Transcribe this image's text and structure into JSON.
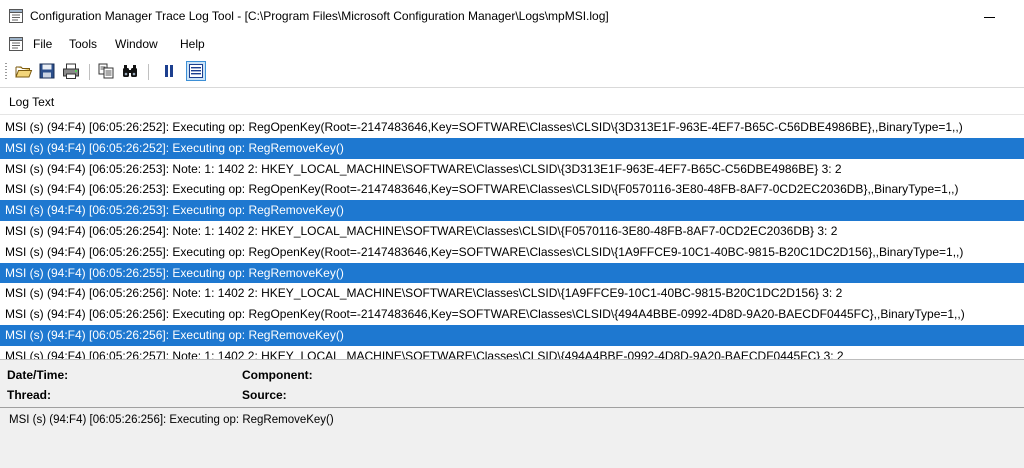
{
  "window": {
    "title": "Configuration Manager Trace Log Tool - [C:\\Program Files\\Microsoft Configuration Manager\\Logs\\mpMSI.log]"
  },
  "menu": {
    "items": [
      "File",
      "Tools",
      "Window",
      "Help"
    ]
  },
  "toolbar": {
    "buttons": [
      "open-icon",
      "save-icon",
      "print-icon",
      "copy-icon",
      "find-icon",
      "pause-icon",
      "highlight-icon"
    ]
  },
  "log": {
    "header": "Log Text",
    "rows": [
      {
        "text": "MSI (s) (94:F4) [06:05:26:252]: Executing op: RegOpenKey(Root=-2147483646,Key=SOFTWARE\\Classes\\CLSID\\{3D313E1F-963E-4EF7-B65C-C56DBE4986BE},,BinaryType=1,,)",
        "selected": false
      },
      {
        "text": "MSI (s) (94:F4) [06:05:26:252]: Executing op: RegRemoveKey()",
        "selected": true
      },
      {
        "text": "MSI (s) (94:F4) [06:05:26:253]: Note: 1: 1402 2: HKEY_LOCAL_MACHINE\\SOFTWARE\\Classes\\CLSID\\{3D313E1F-963E-4EF7-B65C-C56DBE4986BE} 3: 2",
        "selected": false
      },
      {
        "text": "MSI (s) (94:F4) [06:05:26:253]: Executing op: RegOpenKey(Root=-2147483646,Key=SOFTWARE\\Classes\\CLSID\\{F0570116-3E80-48FB-8AF7-0CD2EC2036DB},,BinaryType=1,,)",
        "selected": false
      },
      {
        "text": "MSI (s) (94:F4) [06:05:26:253]: Executing op: RegRemoveKey()",
        "selected": true
      },
      {
        "text": "MSI (s) (94:F4) [06:05:26:254]: Note: 1: 1402 2: HKEY_LOCAL_MACHINE\\SOFTWARE\\Classes\\CLSID\\{F0570116-3E80-48FB-8AF7-0CD2EC2036DB} 3: 2",
        "selected": false
      },
      {
        "text": "MSI (s) (94:F4) [06:05:26:255]: Executing op: RegOpenKey(Root=-2147483646,Key=SOFTWARE\\Classes\\CLSID\\{1A9FFCE9-10C1-40BC-9815-B20C1DC2D156},,BinaryType=1,,)",
        "selected": false
      },
      {
        "text": "MSI (s) (94:F4) [06:05:26:255]: Executing op: RegRemoveKey()",
        "selected": true
      },
      {
        "text": "MSI (s) (94:F4) [06:05:26:256]: Note: 1: 1402 2: HKEY_LOCAL_MACHINE\\SOFTWARE\\Classes\\CLSID\\{1A9FFCE9-10C1-40BC-9815-B20C1DC2D156} 3: 2",
        "selected": false
      },
      {
        "text": "MSI (s) (94:F4) [06:05:26:256]: Executing op: RegOpenKey(Root=-2147483646,Key=SOFTWARE\\Classes\\CLSID\\{494A4BBE-0992-4D8D-9A20-BAECDF0445FC},,BinaryType=1,,)",
        "selected": false
      },
      {
        "text": "MSI (s) (94:F4) [06:05:26:256]: Executing op: RegRemoveKey()",
        "selected": true
      },
      {
        "text": "MSI (s) (94:F4) [06:05:26:257]: Note: 1: 1402 2: HKEY_LOCAL_MACHINE\\SOFTWARE\\Classes\\CLSID\\{494A4BBE-0992-4D8D-9A20-BAECDF0445FC} 3: 2",
        "selected": false
      }
    ]
  },
  "details": {
    "datetime_label": "Date/Time:",
    "datetime_value": "",
    "component_label": "Component:",
    "component_value": "",
    "thread_label": "Thread:",
    "thread_value": "",
    "source_label": "Source:",
    "source_value": ""
  },
  "message": {
    "text": "MSI (s) (94:F4) [06:05:26:256]: Executing op: RegRemoveKey()"
  },
  "colors": {
    "selection": "#1e78d0",
    "panel": "#f0f0f0"
  }
}
